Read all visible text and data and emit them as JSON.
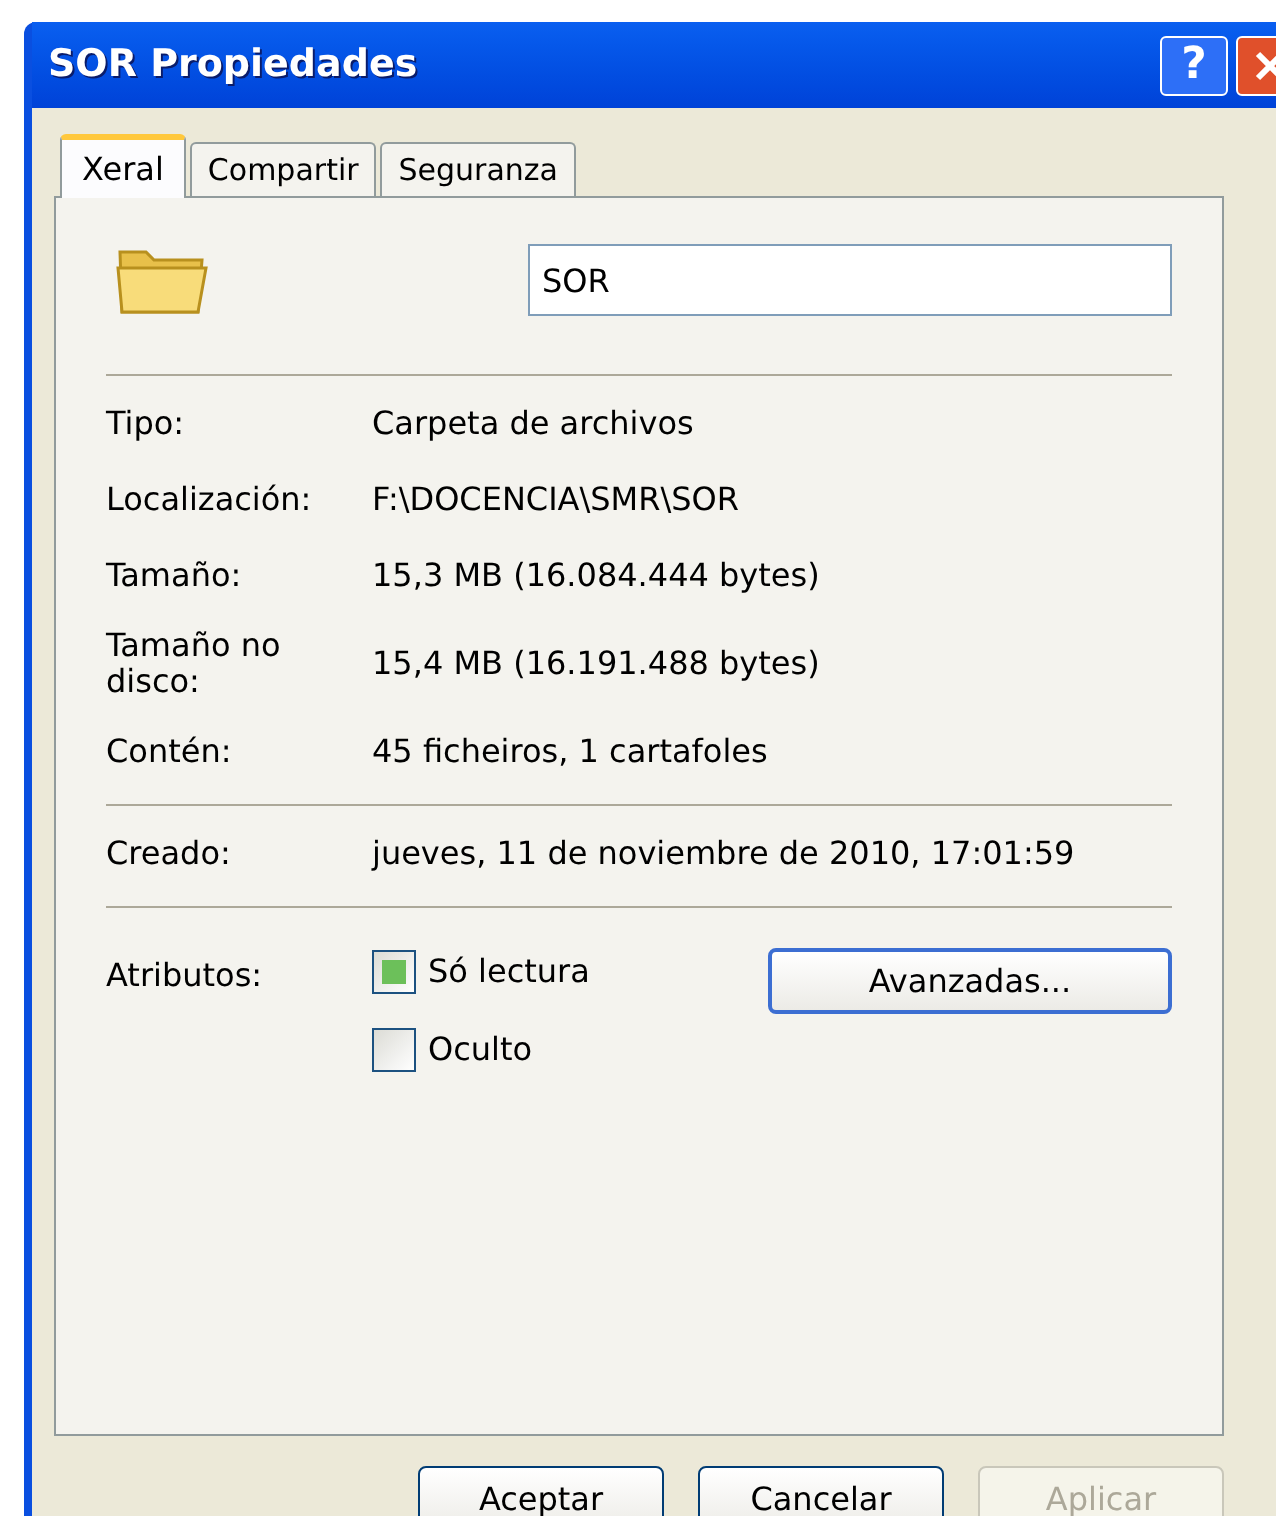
{
  "window": {
    "title": "SOR Propiedades",
    "help_button": "?"
  },
  "tabs": [
    {
      "label": "Xeral",
      "selected": true
    },
    {
      "label": "Compartir",
      "selected": false
    },
    {
      "label": "Seguranza",
      "selected": false
    }
  ],
  "name_field": {
    "value": "SOR"
  },
  "groups": [
    [
      {
        "label": "Tipo:",
        "value": "Carpeta de archivos"
      },
      {
        "label": "Localización:",
        "value": "F:\\DOCENCIA\\SMR\\SOR"
      },
      {
        "label": "Tamaño:",
        "value": "15,3 MB (16.084.444 bytes)"
      },
      {
        "label": "Tamaño no disco:",
        "value": "15,4 MB (16.191.488 bytes)"
      },
      {
        "label": "Contén:",
        "value": "45 ficheiros, 1 cartafoles"
      }
    ],
    [
      {
        "label": "Creado:",
        "value": "jueves, 11 de noviembre de 2010, 17:01:59"
      }
    ]
  ],
  "attributes": {
    "label": "Atributos:",
    "checkboxes": [
      {
        "label": "Só lectura",
        "checked": true
      },
      {
        "label": "Oculto",
        "checked": false
      }
    ],
    "advanced_button": "Avanzadas..."
  },
  "buttons": [
    {
      "label": "Aceptar",
      "disabled": false
    },
    {
      "label": "Cancelar",
      "disabled": false
    },
    {
      "label": "Aplicar",
      "disabled": true
    }
  ]
}
